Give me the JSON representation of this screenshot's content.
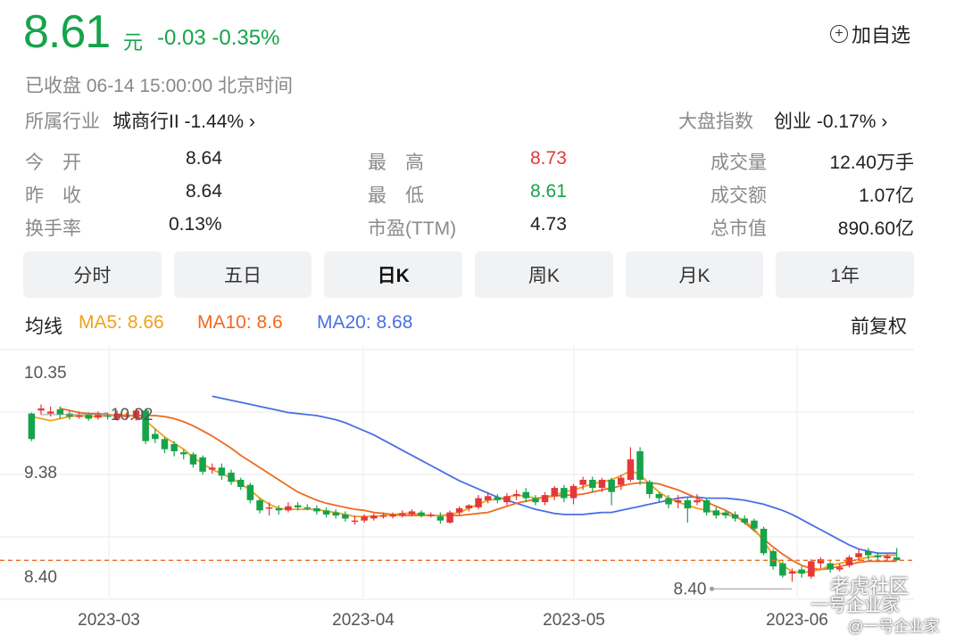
{
  "quote": {
    "price": "8.61",
    "unit": "元",
    "change": "-0.03 -0.35%",
    "add_favorite": "加自选",
    "status": "已收盘  06-14 15:00:00  北京时间"
  },
  "industry": {
    "label": "所属行业",
    "value": "城商行II -1.44% ›"
  },
  "index": {
    "label": "大盘指数",
    "value": "创业 -0.17% ›"
  },
  "stats": {
    "open_label": "今　开",
    "open_value": "8.64",
    "prev_label": "昨　收",
    "prev_value": "8.64",
    "turnover_label": "换手率",
    "turnover_value": "0.13%",
    "high_label": "最　高",
    "high_value": "8.73",
    "low_label": "最　低",
    "low_value": "8.61",
    "pe_label": "市盈(TTM)",
    "pe_value": "4.73",
    "volume_label": "成交量",
    "volume_value": "12.40万手",
    "amount_label": "成交额",
    "amount_value": "1.07亿",
    "mcap_label": "总市值",
    "mcap_value": "890.60亿"
  },
  "tabs": [
    "分时",
    "五日",
    "日K",
    "周K",
    "月K",
    "1年"
  ],
  "active_tab": "日K",
  "ma_legend": {
    "title": "均线",
    "ma5": "MA5: 8.66",
    "ma10": "MA10: 8.6",
    "ma20": "MA20: 8.68",
    "adjust": "前复权"
  },
  "colors": {
    "up": "#e5383b",
    "down": "#16a34a",
    "ma5": "#f2a11a",
    "ma10": "#ef6a1f",
    "ma20": "#4a6fe3"
  },
  "chart_data": {
    "type": "candlestick",
    "y_ticks": [
      "10.35",
      "9.38",
      "8.40"
    ],
    "x_ticks": [
      "2023-03",
      "2023-04",
      "2023-05",
      "2023-06"
    ],
    "annotations": {
      "max": "10.02",
      "min": "8.40"
    },
    "reference_price": 8.61,
    "ylim": [
      8.28,
      10.45
    ],
    "candles": [
      {
        "o": 10.05,
        "c": 9.8,
        "h": 10.06,
        "l": 9.78
      },
      {
        "o": 10.08,
        "c": 10.1,
        "h": 10.14,
        "l": 10.04
      },
      {
        "o": 10.05,
        "c": 10.07,
        "h": 10.12,
        "l": 10.02
      },
      {
        "o": 10.09,
        "c": 10.04,
        "h": 10.12,
        "l": 10.0
      },
      {
        "o": 10.05,
        "c": 10.02,
        "h": 10.08,
        "l": 9.99
      },
      {
        "o": 10.02,
        "c": 10.03,
        "h": 10.07,
        "l": 10.0
      },
      {
        "o": 10.04,
        "c": 10.0,
        "h": 10.06,
        "l": 9.98
      },
      {
        "o": 10.01,
        "c": 10.04,
        "h": 10.07,
        "l": 9.99
      },
      {
        "o": 10.03,
        "c": 10.02,
        "h": 10.06,
        "l": 9.99
      },
      {
        "o": 10.0,
        "c": 10.05,
        "h": 10.08,
        "l": 9.98
      },
      {
        "o": 10.02,
        "c": 10.03,
        "h": 10.06,
        "l": 9.99
      },
      {
        "o": 10.0,
        "c": 10.08,
        "h": 10.1,
        "l": 9.98
      },
      {
        "o": 10.08,
        "c": 9.78,
        "h": 10.1,
        "l": 9.75
      },
      {
        "o": 9.85,
        "c": 9.8,
        "h": 9.9,
        "l": 9.76
      },
      {
        "o": 9.8,
        "c": 9.7,
        "h": 9.82,
        "l": 9.66
      },
      {
        "o": 9.75,
        "c": 9.68,
        "h": 9.78,
        "l": 9.63
      },
      {
        "o": 9.67,
        "c": 9.65,
        "h": 9.7,
        "l": 9.6
      },
      {
        "o": 9.65,
        "c": 9.55,
        "h": 9.67,
        "l": 9.52
      },
      {
        "o": 9.62,
        "c": 9.48,
        "h": 9.64,
        "l": 9.45
      },
      {
        "o": 9.5,
        "c": 9.52,
        "h": 9.56,
        "l": 9.46
      },
      {
        "o": 9.52,
        "c": 9.44,
        "h": 9.56,
        "l": 9.4
      },
      {
        "o": 9.47,
        "c": 9.38,
        "h": 9.5,
        "l": 9.35
      },
      {
        "o": 9.4,
        "c": 9.33,
        "h": 9.42,
        "l": 9.3
      },
      {
        "o": 9.35,
        "c": 9.2,
        "h": 9.37,
        "l": 9.17
      },
      {
        "o": 9.2,
        "c": 9.1,
        "h": 9.22,
        "l": 9.07
      },
      {
        "o": 9.12,
        "c": 9.13,
        "h": 9.18,
        "l": 9.05
      },
      {
        "o": 9.12,
        "c": 9.1,
        "h": 9.15,
        "l": 9.06
      },
      {
        "o": 9.1,
        "c": 9.14,
        "h": 9.18,
        "l": 9.08
      },
      {
        "o": 9.15,
        "c": 9.13,
        "h": 9.18,
        "l": 9.1
      },
      {
        "o": 9.13,
        "c": 9.12,
        "h": 9.16,
        "l": 9.1
      },
      {
        "o": 9.12,
        "c": 9.09,
        "h": 9.15,
        "l": 9.06
      },
      {
        "o": 9.1,
        "c": 9.06,
        "h": 9.13,
        "l": 9.03
      },
      {
        "o": 9.08,
        "c": 9.05,
        "h": 9.11,
        "l": 9.02
      },
      {
        "o": 9.06,
        "c": 9.02,
        "h": 9.09,
        "l": 8.99
      },
      {
        "o": 9.0,
        "c": 9.0,
        "h": 9.05,
        "l": 8.96
      },
      {
        "o": 9.0,
        "c": 9.04,
        "h": 9.06,
        "l": 8.98
      },
      {
        "o": 9.02,
        "c": 9.05,
        "h": 9.07,
        "l": 9.0
      },
      {
        "o": 9.05,
        "c": 9.05,
        "h": 9.08,
        "l": 9.02
      },
      {
        "o": 9.04,
        "c": 9.06,
        "h": 9.08,
        "l": 9.02
      },
      {
        "o": 9.05,
        "c": 9.07,
        "h": 9.1,
        "l": 9.03
      },
      {
        "o": 9.06,
        "c": 9.09,
        "h": 9.11,
        "l": 9.04
      },
      {
        "o": 9.08,
        "c": 9.05,
        "h": 9.1,
        "l": 9.03
      },
      {
        "o": 9.06,
        "c": 9.06,
        "h": 9.08,
        "l": 9.03
      },
      {
        "o": 9.04,
        "c": 9.0,
        "h": 9.08,
        "l": 8.97
      },
      {
        "o": 8.98,
        "c": 9.08,
        "h": 9.1,
        "l": 8.97
      },
      {
        "o": 9.08,
        "c": 9.12,
        "h": 9.14,
        "l": 9.05
      },
      {
        "o": 9.12,
        "c": 9.15,
        "h": 9.16,
        "l": 9.09
      },
      {
        "o": 9.13,
        "c": 9.22,
        "h": 9.25,
        "l": 9.11
      },
      {
        "o": 9.2,
        "c": 9.24,
        "h": 9.28,
        "l": 9.17
      },
      {
        "o": 9.23,
        "c": 9.2,
        "h": 9.26,
        "l": 9.17
      },
      {
        "o": 9.18,
        "c": 9.24,
        "h": 9.27,
        "l": 9.15
      },
      {
        "o": 9.24,
        "c": 9.26,
        "h": 9.3,
        "l": 9.2
      },
      {
        "o": 9.28,
        "c": 9.22,
        "h": 9.32,
        "l": 9.18
      },
      {
        "o": 9.22,
        "c": 9.18,
        "h": 9.25,
        "l": 9.15
      },
      {
        "o": 9.18,
        "c": 9.25,
        "h": 9.28,
        "l": 9.15
      },
      {
        "o": 9.24,
        "c": 9.32,
        "h": 9.34,
        "l": 9.2
      },
      {
        "o": 9.32,
        "c": 9.22,
        "h": 9.35,
        "l": 9.18
      },
      {
        "o": 9.22,
        "c": 9.34,
        "h": 9.36,
        "l": 9.16
      },
      {
        "o": 9.35,
        "c": 9.4,
        "h": 9.43,
        "l": 9.3
      },
      {
        "o": 9.4,
        "c": 9.32,
        "h": 9.43,
        "l": 9.28
      },
      {
        "o": 9.32,
        "c": 9.4,
        "h": 9.42,
        "l": 9.28
      },
      {
        "o": 9.4,
        "c": 9.28,
        "h": 9.42,
        "l": 9.15
      },
      {
        "o": 9.35,
        "c": 9.42,
        "h": 9.45,
        "l": 9.3
      },
      {
        "o": 9.4,
        "c": 9.6,
        "h": 9.72,
        "l": 9.38
      },
      {
        "o": 9.68,
        "c": 9.4,
        "h": 9.72,
        "l": 9.35
      },
      {
        "o": 9.38,
        "c": 9.26,
        "h": 9.4,
        "l": 9.22
      },
      {
        "o": 9.26,
        "c": 9.22,
        "h": 9.28,
        "l": 9.18
      },
      {
        "o": 9.22,
        "c": 9.16,
        "h": 9.25,
        "l": 9.12
      },
      {
        "o": 9.18,
        "c": 9.2,
        "h": 9.25,
        "l": 9.12
      },
      {
        "o": 9.2,
        "c": 9.12,
        "h": 9.23,
        "l": 8.98
      },
      {
        "o": 9.18,
        "c": 9.2,
        "h": 9.26,
        "l": 9.15
      },
      {
        "o": 9.2,
        "c": 9.08,
        "h": 9.22,
        "l": 9.05
      },
      {
        "o": 9.1,
        "c": 9.05,
        "h": 9.13,
        "l": 9.02
      },
      {
        "o": 9.08,
        "c": 9.05,
        "h": 9.1,
        "l": 9.02
      },
      {
        "o": 9.06,
        "c": 9.02,
        "h": 9.09,
        "l": 8.99
      },
      {
        "o": 9.02,
        "c": 8.98,
        "h": 9.05,
        "l": 8.96
      },
      {
        "o": 9.0,
        "c": 8.92,
        "h": 9.02,
        "l": 8.9
      },
      {
        "o": 8.92,
        "c": 8.68,
        "h": 8.94,
        "l": 8.66
      },
      {
        "o": 8.7,
        "c": 8.55,
        "h": 8.72,
        "l": 8.52
      },
      {
        "o": 8.58,
        "c": 8.46,
        "h": 8.6,
        "l": 8.44
      },
      {
        "o": 8.48,
        "c": 8.5,
        "h": 8.53,
        "l": 8.4
      },
      {
        "o": 8.52,
        "c": 8.48,
        "h": 8.55,
        "l": 8.44
      },
      {
        "o": 8.45,
        "c": 8.6,
        "h": 8.62,
        "l": 8.43
      },
      {
        "o": 8.58,
        "c": 8.62,
        "h": 8.64,
        "l": 8.52
      },
      {
        "o": 8.58,
        "c": 8.52,
        "h": 8.6,
        "l": 8.49
      },
      {
        "o": 8.52,
        "c": 8.54,
        "h": 8.58,
        "l": 8.5
      },
      {
        "o": 8.56,
        "c": 8.64,
        "h": 8.66,
        "l": 8.54
      },
      {
        "o": 8.64,
        "c": 8.68,
        "h": 8.72,
        "l": 8.6
      },
      {
        "o": 8.7,
        "c": 8.66,
        "h": 8.73,
        "l": 8.62
      },
      {
        "o": 8.66,
        "c": 8.64,
        "h": 8.69,
        "l": 8.61
      },
      {
        "o": 8.63,
        "c": 8.65,
        "h": 8.67,
        "l": 8.6
      },
      {
        "o": 8.64,
        "c": 8.61,
        "h": 8.73,
        "l": 8.61
      }
    ],
    "ma5": [
      10.02,
      10.0,
      9.98,
      10.0,
      10.02,
      10.03,
      10.02,
      10.02,
      10.03,
      10.03,
      10.04,
      10.02,
      9.98,
      9.9,
      9.82,
      9.76,
      9.7,
      9.62,
      9.56,
      9.5,
      9.46,
      9.42,
      9.36,
      9.3,
      9.22,
      9.16,
      9.12,
      9.11,
      9.11,
      9.11,
      9.11,
      9.09,
      9.08,
      9.06,
      9.04,
      9.04,
      9.04,
      9.05,
      9.06,
      9.07,
      9.07,
      9.06,
      9.05,
      9.05,
      9.06,
      9.08,
      9.12,
      9.16,
      9.2,
      9.21,
      9.23,
      9.25,
      9.24,
      9.22,
      9.23,
      9.25,
      9.28,
      9.3,
      9.33,
      9.36,
      9.38,
      9.4,
      9.44,
      9.49,
      9.45,
      9.36,
      9.28,
      9.22,
      9.18,
      9.15,
      9.12,
      9.1,
      9.08,
      9.06,
      9.04,
      9.0,
      8.92,
      8.8,
      8.66,
      8.56,
      8.5,
      8.49,
      8.5,
      8.52,
      8.56,
      8.58,
      8.6,
      8.62,
      8.64,
      8.65,
      8.66,
      8.66
    ],
    "ma10": [
      10.1,
      10.08,
      10.06,
      10.05,
      10.05,
      10.04,
      10.03,
      10.03,
      10.03,
      10.03,
      10.03,
      10.02,
      10.0,
      9.97,
      9.93,
      9.88,
      9.83,
      9.77,
      9.71,
      9.64,
      9.58,
      9.52,
      9.46,
      9.4,
      9.34,
      9.28,
      9.24,
      9.2,
      9.17,
      9.15,
      9.13,
      9.11,
      9.1,
      9.08,
      9.07,
      9.06,
      9.05,
      9.05,
      9.05,
      9.05,
      9.05,
      9.05,
      9.05,
      9.06,
      9.07,
      9.08,
      9.11,
      9.14,
      9.17,
      9.19,
      9.21,
      9.23,
      9.24,
      9.25,
      9.25,
      9.26,
      9.28,
      9.3,
      9.32,
      9.34,
      9.36,
      9.37,
      9.37,
      9.36,
      9.33,
      9.3,
      9.26,
      9.22,
      9.18,
      9.14,
      9.1,
      9.05,
      8.98,
      8.9,
      8.82,
      8.74,
      8.67,
      8.61,
      8.56,
      8.53,
      8.52,
      8.53,
      8.55,
      8.57,
      8.59,
      8.6,
      8.6,
      8.6,
      8.6
    ],
    "ma20": [
      10.22,
      10.2,
      10.18,
      10.16,
      10.14,
      10.12,
      10.1,
      10.08,
      10.06,
      10.05,
      10.04,
      10.03,
      10.01,
      9.99,
      9.96,
      9.92,
      9.88,
      9.84,
      9.79,
      9.74,
      9.69,
      9.64,
      9.59,
      9.54,
      9.49,
      9.44,
      9.39,
      9.35,
      9.31,
      9.27,
      9.23,
      9.2,
      9.17,
      9.14,
      9.11,
      9.09,
      9.07,
      9.06,
      9.06,
      9.06,
      9.07,
      9.08,
      9.08,
      9.1,
      9.12,
      9.14,
      9.16,
      9.18,
      9.2,
      9.22,
      9.23,
      9.23,
      9.22,
      9.22,
      9.22,
      9.21,
      9.2,
      9.18,
      9.16,
      9.13,
      9.1,
      9.06,
      9.01,
      8.96,
      8.91,
      8.86,
      8.81,
      8.76,
      8.72,
      8.7,
      8.68,
      8.68,
      8.68
    ]
  },
  "watermark": {
    "text1": "老虎社区",
    "text2": "一号企业家",
    "text3": "@一号企业家"
  }
}
